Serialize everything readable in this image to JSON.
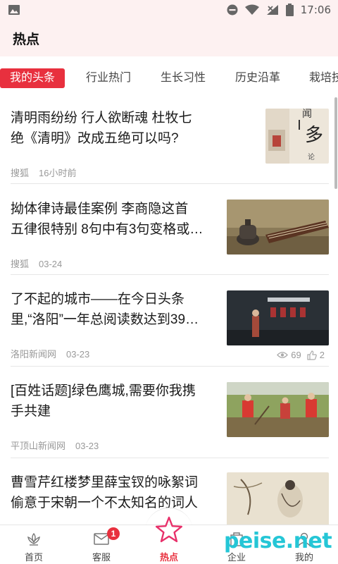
{
  "status_bar": {
    "time": "17:06"
  },
  "header": {
    "title": "热点"
  },
  "tabs": [
    {
      "label": "我的头条",
      "active": true
    },
    {
      "label": "行业热门"
    },
    {
      "label": "生长习性"
    },
    {
      "label": "历史沿革"
    },
    {
      "label": "栽培技"
    }
  ],
  "feed": [
    {
      "title_line1": "清明雨纷纷 行人欲断魂 杜牧七",
      "title_line2": "绝《清明》改成五绝可以吗?",
      "source": "搜狐",
      "time": "16小时前",
      "thumb": "book-cover-image"
    },
    {
      "title_line1": "拗体律诗最佳案例 李商隐这首",
      "title_line2": "五律很特别 8句中有3句变格或…",
      "source": "搜狐",
      "time": "03-24",
      "thumb": "guqin-incense-image"
    },
    {
      "title_line1": "了不起的城市——在今日头条",
      "title_line2": "里,“洛阳”一年总阅读数达到39…",
      "source": "洛阳新闻网",
      "time": "03-23",
      "views": "69",
      "likes": "2",
      "thumb": "stage-event-image"
    },
    {
      "title_line1": "[百姓话题]绿色鹰城,需要你我携",
      "title_line2": "手共建",
      "source": "平顶山新闻网",
      "time": "03-23",
      "thumb": "tree-planting-image"
    },
    {
      "title_line1": "曹雪芹红楼梦里薛宝钗的咏絮词",
      "title_line2": "偷意于宋朝一个不太知名的词人",
      "thumb": "ink-painting-image"
    }
  ],
  "bottom_nav": [
    {
      "label": "首页",
      "icon": "lotus-home-icon"
    },
    {
      "label": "客服",
      "icon": "message-icon",
      "badge": "1"
    },
    {
      "label": "热点",
      "icon": "star-icon",
      "active": true
    },
    {
      "label": "企业",
      "icon": "enterprise-icon"
    },
    {
      "label": "我的",
      "icon": "user-icon"
    }
  ],
  "watermark": "peise.net",
  "colors": {
    "accent": "#e8303e",
    "header_bg": "#fdf1f1",
    "watermark": "#25c6d6"
  }
}
